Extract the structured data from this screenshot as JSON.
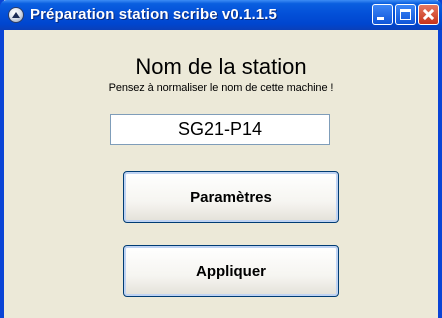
{
  "window": {
    "title": "Préparation station scribe v0.1.1.5",
    "icon": "app-icon",
    "controls": [
      "minimize-icon",
      "maximize-icon",
      "close-icon"
    ]
  },
  "main": {
    "heading": "Nom de la station",
    "hint": "Pensez à normaliser le nom de cette machine !",
    "station_name_value": "SG21-P14",
    "params_button": "Paramètres",
    "apply_button": "Appliquer"
  },
  "colors": {
    "titlebar": "#0350d8",
    "window_body": "#ece9d8",
    "close_button": "#c8331a"
  }
}
